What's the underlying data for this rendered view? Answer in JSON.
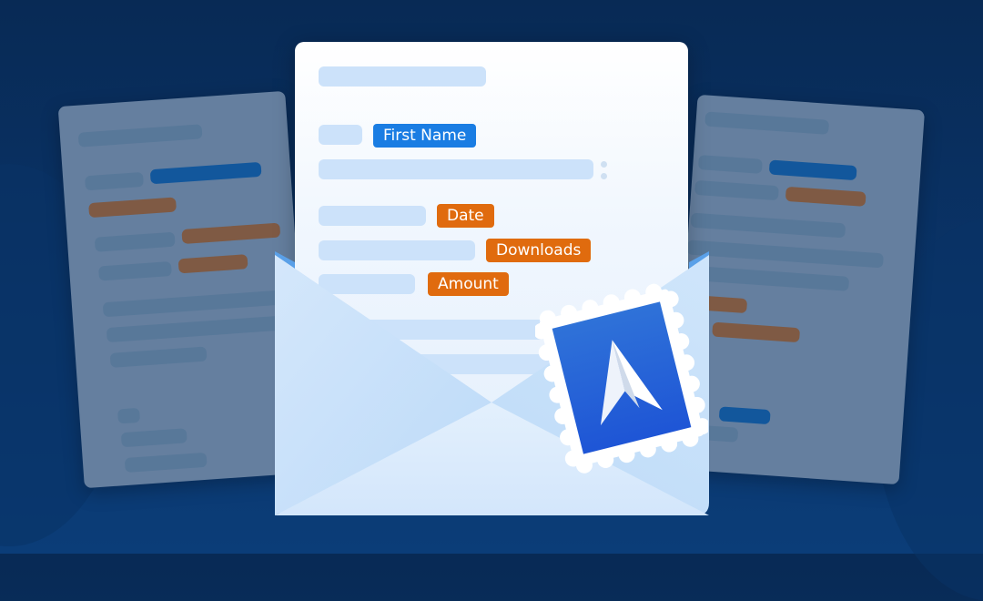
{
  "illustration": {
    "subject": "open email envelope with mail-merge template letter",
    "colors": {
      "background": "#0a3469",
      "background_sheet": "#657f9f",
      "paper": "#ffffff",
      "placeholder_bar": "#cce2fa",
      "tag_blue": "#1a7de3",
      "tag_orange": "#e06b0e",
      "stamp_blue": "#2462d6"
    },
    "tags": {
      "first_name": "First Name",
      "date": "Date",
      "downloads": "Downloads",
      "amount": "Amount"
    },
    "stamp_icon": "paper-plane-icon"
  }
}
